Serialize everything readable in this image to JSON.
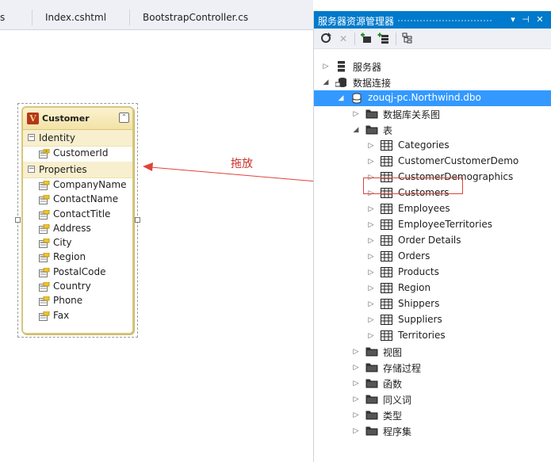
{
  "doc_tabs": [
    "s",
    "Index.cshtml",
    "BootstrapController.cs"
  ],
  "entity": {
    "name": "Customer",
    "sections": {
      "identity": "Identity",
      "properties": "Properties"
    },
    "identity_fields": [
      "CustomerId"
    ],
    "property_fields": [
      "CompanyName",
      "ContactName",
      "ContactTitle",
      "Address",
      "City",
      "Region",
      "PostalCode",
      "Country",
      "Phone",
      "Fax"
    ]
  },
  "annotation": {
    "label": "拖放",
    "color": "#e0423a"
  },
  "server_explorer": {
    "title": "服务器资源管理器",
    "title_buttons": [
      "▾",
      "⊣",
      "✕"
    ],
    "toolbar_icons": [
      "refresh-icon",
      "stop-icon",
      "connect-to-database-icon",
      "connect-to-server-icon",
      "properties-icon"
    ],
    "tree": [
      {
        "label": "服务器",
        "level": 0,
        "expander": "collapsed",
        "icon": "server-icon"
      },
      {
        "label": "数据连接",
        "level": 0,
        "expander": "expanded",
        "icon": "data-connections-icon"
      },
      {
        "label": "zouqj-pc.Northwind.dbo",
        "level": 1,
        "expander": "expanded",
        "icon": "database-icon",
        "selected": true
      },
      {
        "label": "数据库关系图",
        "level": 2,
        "expander": "collapsed",
        "icon": "folder-icon"
      },
      {
        "label": "表",
        "level": 2,
        "expander": "expanded",
        "icon": "folder-icon"
      },
      {
        "label": "Categories",
        "level": 3,
        "expander": "collapsed",
        "icon": "table-icon"
      },
      {
        "label": "CustomerCustomerDemo",
        "level": 3,
        "expander": "collapsed",
        "icon": "table-icon"
      },
      {
        "label": "CustomerDemographics",
        "level": 3,
        "expander": "collapsed",
        "icon": "table-icon"
      },
      {
        "label": "Customers",
        "level": 3,
        "expander": "collapsed",
        "icon": "table-icon",
        "highlighted": true
      },
      {
        "label": "Employees",
        "level": 3,
        "expander": "collapsed",
        "icon": "table-icon"
      },
      {
        "label": "EmployeeTerritories",
        "level": 3,
        "expander": "collapsed",
        "icon": "table-icon"
      },
      {
        "label": "Order Details",
        "level": 3,
        "expander": "collapsed",
        "icon": "table-icon"
      },
      {
        "label": "Orders",
        "level": 3,
        "expander": "collapsed",
        "icon": "table-icon"
      },
      {
        "label": "Products",
        "level": 3,
        "expander": "collapsed",
        "icon": "table-icon"
      },
      {
        "label": "Region",
        "level": 3,
        "expander": "collapsed",
        "icon": "table-icon"
      },
      {
        "label": "Shippers",
        "level": 3,
        "expander": "collapsed",
        "icon": "table-icon"
      },
      {
        "label": "Suppliers",
        "level": 3,
        "expander": "collapsed",
        "icon": "table-icon"
      },
      {
        "label": "Territories",
        "level": 3,
        "expander": "collapsed",
        "icon": "table-icon"
      },
      {
        "label": "视图",
        "level": 2,
        "expander": "collapsed",
        "icon": "folder-icon"
      },
      {
        "label": "存储过程",
        "level": 2,
        "expander": "collapsed",
        "icon": "folder-icon"
      },
      {
        "label": "函数",
        "level": 2,
        "expander": "collapsed",
        "icon": "folder-icon"
      },
      {
        "label": "同义词",
        "level": 2,
        "expander": "collapsed",
        "icon": "folder-icon"
      },
      {
        "label": "类型",
        "level": 2,
        "expander": "collapsed",
        "icon": "folder-icon"
      },
      {
        "label": "程序集",
        "level": 2,
        "expander": "collapsed",
        "icon": "folder-icon"
      }
    ]
  },
  "colors": {
    "accent": "#007acc",
    "selection": "#3399ff",
    "entity_border": "#d8c67a",
    "entity_header": "#f3e3a6"
  }
}
